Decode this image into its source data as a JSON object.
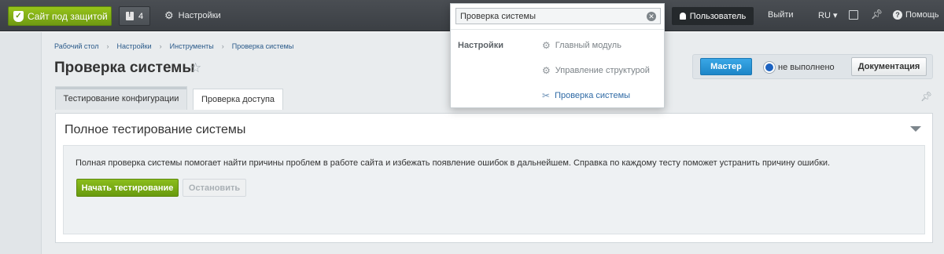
{
  "topbar": {
    "site_button": "Сайт под защитой",
    "notifications_count": "4",
    "settings": "Настройки",
    "user_button": "Пользователь",
    "exit": "Выйти",
    "lang": "RU",
    "help": "Помощь"
  },
  "search": {
    "value": "Проверка системы",
    "group": "Настройки",
    "results": [
      {
        "label": "Главный модуль",
        "icon": "gear-icon"
      },
      {
        "label": "Управление структурой",
        "icon": "gear-icon"
      },
      {
        "label": "Проверка системы",
        "icon": "tools-icon"
      }
    ]
  },
  "breadcrumb": [
    "Рабочий стол",
    "Настройки",
    "Инструменты",
    "Проверка системы"
  ],
  "page_title": "Проверка системы",
  "wizard": {
    "master_button": "Мастер",
    "status": "не выполнено",
    "docs_button": "Документация"
  },
  "tabs": [
    {
      "label": "Тестирование конфигурации",
      "active": true
    },
    {
      "label": "Проверка доступа",
      "active": false
    }
  ],
  "section": {
    "title": "Полное тестирование системы",
    "description": "Полная проверка системы помогает найти причины проблем в работе сайта и избежать появление ошибок в дальнейшем. Справка по каждому тесту поможет устранить причину ошибки.",
    "start_button": "Начать тестирование",
    "stop_button": "Остановить"
  },
  "colors": {
    "accent_green": "#7aaa14",
    "accent_blue": "#1d86c8",
    "topbar": "#43474c"
  }
}
